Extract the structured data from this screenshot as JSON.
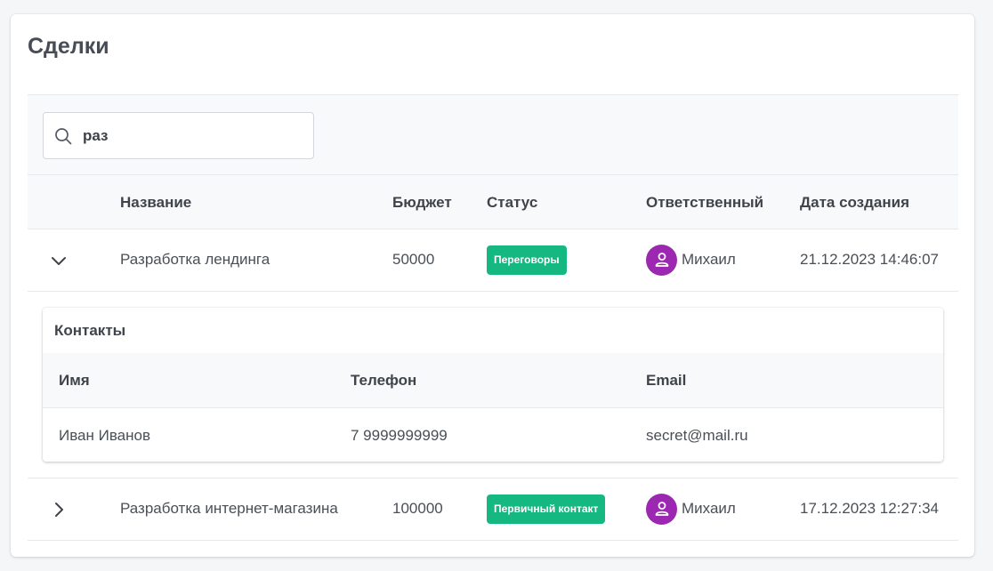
{
  "page": {
    "title": "Сделки"
  },
  "search": {
    "value": "раз",
    "icon": "search-icon"
  },
  "table": {
    "headers": [
      "Название",
      "Бюджет",
      "Статус",
      "Ответственный",
      "Дата создания"
    ],
    "rows": [
      {
        "expanded": true,
        "expander_icon": "chevron-down-icon",
        "name": "Разработка лендинга",
        "budget": "50000",
        "status": "Переговоры",
        "status_color": "#15b880",
        "owner": "Михаил",
        "owner_avatar_color": "#9c27b0",
        "created": "21.12.2023 14:46:07"
      },
      {
        "expanded": false,
        "expander_icon": "chevron-right-icon",
        "name": "Разработка интернет-магазина",
        "budget": "100000",
        "status": "Первичный контакт",
        "status_color": "#15b880",
        "owner": "Михаил",
        "owner_avatar_color": "#9c27b0",
        "created": "17.12.2023 12:27:34"
      }
    ]
  },
  "contacts": {
    "title": "Контакты",
    "headers": [
      "Имя",
      "Телефон",
      "Email"
    ],
    "rows": [
      {
        "name": "Иван Иванов",
        "phone": "7 9999999999",
        "email": "secret@mail.ru"
      }
    ]
  }
}
